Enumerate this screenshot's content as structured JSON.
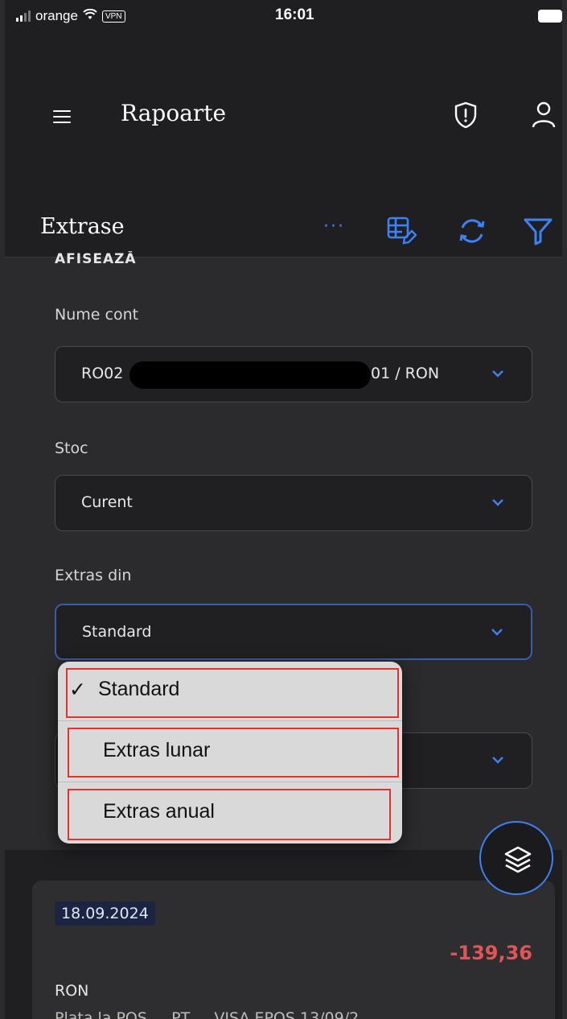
{
  "status_bar": {
    "carrier": "orange",
    "vpn": "VPN",
    "time": "16:01"
  },
  "app_bar": {
    "title": "Rapoarte"
  },
  "section": {
    "title": "Extrase",
    "more": "···"
  },
  "form": {
    "overline": "AFIȘEAZĂ",
    "account": {
      "label": "Nume cont",
      "value_prefix": "RO02",
      "value_suffix": "01 / RON"
    },
    "stock": {
      "label": "Stoc",
      "value": "Curent"
    },
    "statement_from": {
      "label": "Extras din",
      "value": "Standard"
    }
  },
  "dropdown": {
    "options": [
      {
        "label": "Standard",
        "check": "✓",
        "selected": true
      },
      {
        "label": "Extras lunar",
        "selected": false
      },
      {
        "label": "Extras anual",
        "selected": false
      }
    ]
  },
  "transaction": {
    "date": "18.09.2024",
    "amount": "-139,36",
    "currency": "RON",
    "description": "Plata la POS ... PT ... VISA EPOS 13/09/2..."
  },
  "colors": {
    "accent": "#3b82f6",
    "negative": "#e05555",
    "highlight_box": "#e0332f"
  },
  "icons": [
    "menu-icon",
    "shield-icon",
    "user-icon",
    "more-icon",
    "table-edit-icon",
    "refresh-icon",
    "filter-icon",
    "chevron-down-icon",
    "layers-icon"
  ]
}
